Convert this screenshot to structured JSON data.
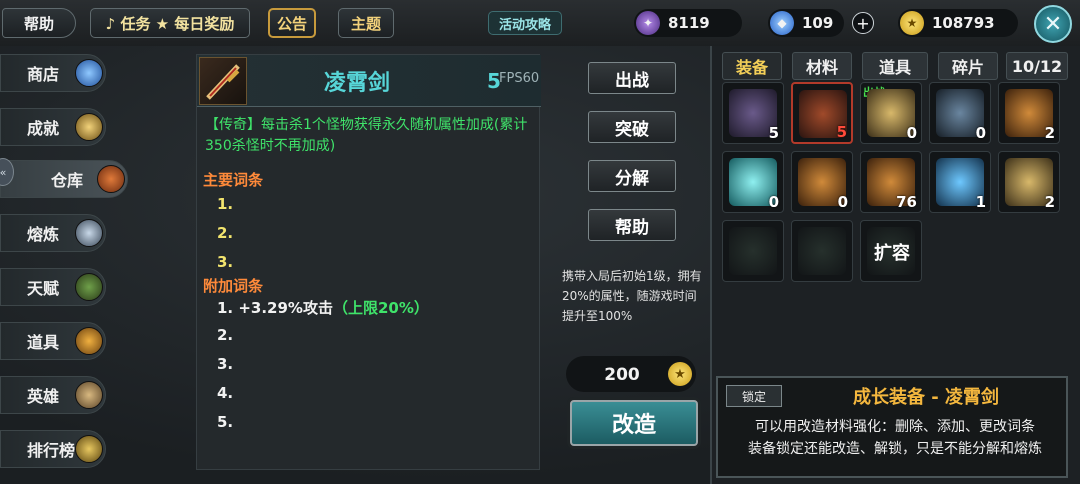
{
  "topbar": {
    "help": "帮助",
    "quest": "♪ 任务 ★ 每日奖励",
    "notice": "公告",
    "theme": "主题",
    "guide": "活动攻略",
    "resources": [
      {
        "icon": "purple-gem-icon",
        "value": "8119",
        "color": "#7a4bb8"
      },
      {
        "icon": "blue-crystal-icon",
        "value": "109",
        "color": "#3f7fe0"
      },
      {
        "icon": "gold-coin-icon",
        "value": "108793",
        "color": "#e8b81f"
      }
    ]
  },
  "sidebar": {
    "items": [
      {
        "label": "商店"
      },
      {
        "label": "成就"
      },
      {
        "label": "仓库"
      },
      {
        "label": "熔炼"
      },
      {
        "label": "天赋"
      },
      {
        "label": "道具"
      },
      {
        "label": "英雄"
      },
      {
        "label": "排行榜"
      }
    ]
  },
  "detail": {
    "name": "凌霄剑",
    "level": "5",
    "fps": "FPS60",
    "legend": "【传奇】每击杀1个怪物获得永久随机属性加成(累计350杀怪时不再加成)",
    "main_title": "主要词条",
    "main_lines": [
      "1.",
      "2.",
      "3."
    ],
    "extra_title": "附加词条",
    "extra_lines": [
      "1. +3.29%攻击",
      "2.",
      "3.",
      "4.",
      "5."
    ],
    "extra_limit": "（上限20%）"
  },
  "actions": {
    "equip": "出战",
    "breakthrough": "突破",
    "decompose": "分解",
    "help": "帮助",
    "carry_note": "携带入局后初始1级，拥有20%的属性，随游戏时间提升至100%",
    "cost": "200",
    "forge": "改造"
  },
  "inventory": {
    "tabs": [
      "装备",
      "材料",
      "道具",
      "碎片"
    ],
    "capacity": "10/12",
    "slots": [
      {
        "qty": "5"
      },
      {
        "qty": "5"
      },
      {
        "qty": "0",
        "badge": "出战"
      },
      {
        "qty": "0"
      },
      {
        "qty": "2"
      },
      {
        "qty": "0"
      },
      {
        "qty": "0"
      },
      {
        "qty": "76"
      },
      {
        "qty": "1"
      },
      {
        "qty": "2"
      }
    ],
    "expand": "扩容"
  },
  "info": {
    "lock": "锁定",
    "title": "成长装备 - 凌霄剑",
    "desc1": "可以用改造材料强化：删除、添加、更改词条",
    "desc2": "装备锁定还能改造、解锁，只是不能分解和熔炼"
  }
}
